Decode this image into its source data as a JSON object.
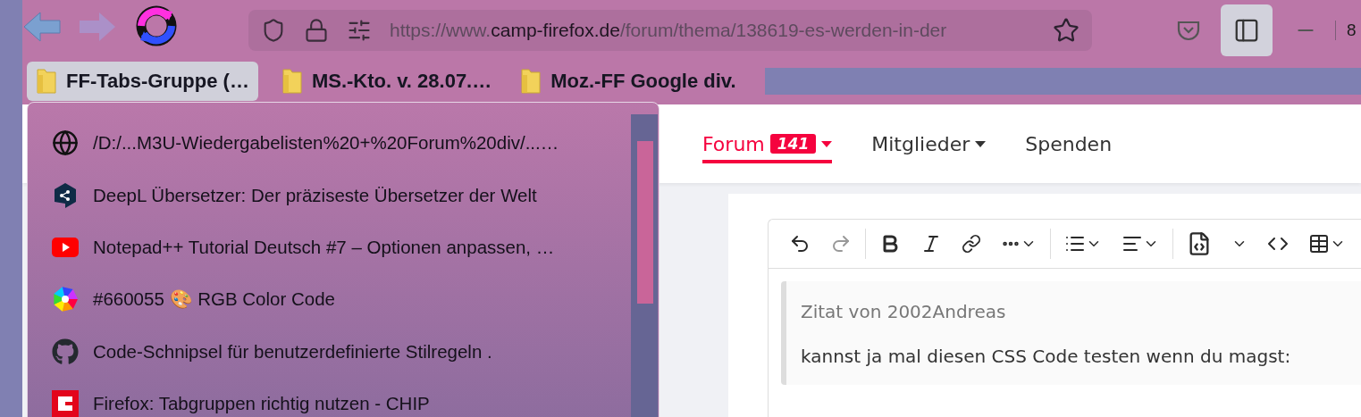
{
  "toolbar": {
    "url": {
      "scheme": "https://www.",
      "domain": "camp-firefox.de",
      "path": "/forum/thema/138619-es-werden-in-der"
    },
    "zoom": "8"
  },
  "bookmarks": [
    {
      "label": "FF-Tabs-Gruppe (…",
      "selected": true
    },
    {
      "label": "MS.-Kto. v. 28.07.…",
      "selected": false
    },
    {
      "label": "Moz.-FF Google div.",
      "selected": false
    }
  ],
  "bookmark_menu": {
    "items": [
      {
        "label": "/D:/...M3U-Wiedergabelisten%20+%20Forum%20div/...…",
        "kind": "globe"
      },
      {
        "label": "DeepL Übersetzer: Der präziseste Übersetzer der Welt",
        "kind": "deepl"
      },
      {
        "label": "Notepad++ Tutorial Deutsch #7 – Optionen anpassen, …",
        "kind": "video"
      },
      {
        "label": "#660055 🎨 RGB Color Code",
        "kind": "colorwheel"
      },
      {
        "label": "Code-Schnipsel für benutzerdefinierte Stilregeln .",
        "kind": "github"
      },
      {
        "label": "Firefox: Tabgruppen richtig nutzen - CHIP",
        "kind": "chip"
      }
    ]
  },
  "site_nav": [
    {
      "label": "Forum",
      "badge": "141",
      "selected": true,
      "caret": true
    },
    {
      "label": "Mitglieder",
      "selected": false,
      "caret": true
    },
    {
      "label": "Spenden",
      "selected": false,
      "caret": false
    }
  ],
  "editor": {
    "quote_title": "Zitat von 2002Andreas",
    "quote_text": "kannst ja mal diesen CSS Code testen wenn du magst:"
  }
}
